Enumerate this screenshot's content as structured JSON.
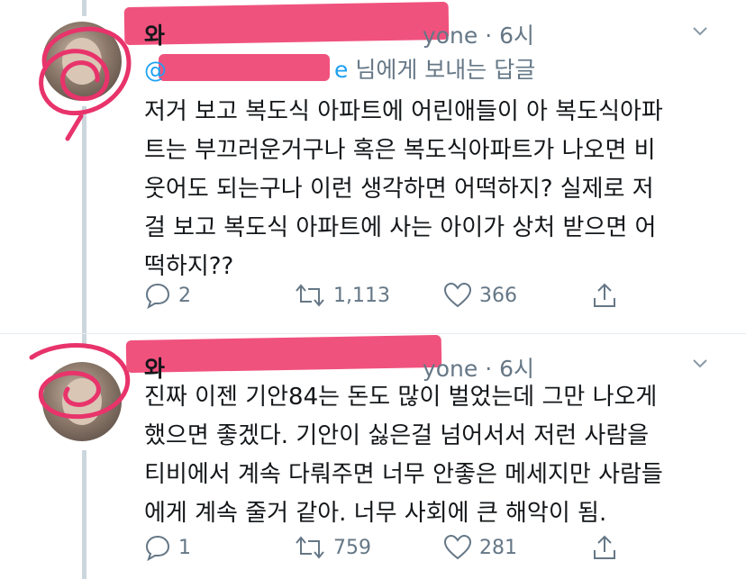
{
  "tweets": [
    {
      "name_initial": "와",
      "handle_tail": "yone",
      "time": "· 6시",
      "reply_handle_tail": "e",
      "reply_text": "님에게 보내는 답글",
      "lines": [
        "저거 보고 복도식 아파트에 어린애들이 아 복도식아파",
        "트는 부끄러운거구나 혹은 복도식아파트가 나오면 비",
        "웃어도 되는구나 이런 생각하면 어떡하지? 실제로 저",
        "걸 보고 복도식 아파트에 사는 아이가 상처 받으면 어",
        "떡하지??"
      ],
      "replies": "2",
      "retweets": "1,113",
      "likes": "366"
    },
    {
      "name_initial": "와",
      "handle_tail": "yone",
      "time": "· 6시",
      "lines": [
        "진짜 이젠 기안84는 돈도 많이 벌었는데 그만 나오게",
        "했으면 좋겠다. 기안이 싫은걸 넘어서서 저런 사람을",
        "티비에서 계속 다뤄주면 너무 안좋은 메세지만 사람들",
        "에게 계속 줄거 같아. 너무 사회에 큰 해악이 됨."
      ],
      "replies": "1",
      "retweets": "759",
      "likes": "281"
    }
  ],
  "icons": {
    "reply": "reply-icon",
    "retweet": "retweet-icon",
    "like": "heart-icon",
    "share": "share-icon",
    "menu": "chevron-down-icon"
  },
  "colors": {
    "text": "#14171a",
    "secondary": "#657786",
    "link": "#1da1f2",
    "thread": "#ccd6dd",
    "scribble": "#e8336b"
  }
}
